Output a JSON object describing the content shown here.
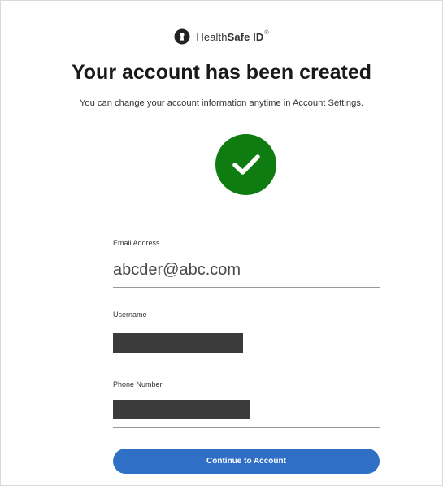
{
  "brand": {
    "name_regular": "Health",
    "name_bold": "Safe ID",
    "trademark": "®",
    "icon": "shield-keyhole-icon"
  },
  "header": {
    "title": "Your account has been created",
    "subtitle": "You can change your account information anytime in Account Settings."
  },
  "status": {
    "icon": "check-circle-icon",
    "color": "#0e7c11"
  },
  "fields": {
    "email": {
      "label": "Email Address",
      "value": "abcder@abc.com"
    },
    "username": {
      "label": "Username",
      "value_redacted": true
    },
    "phone": {
      "label": "Phone Number",
      "value_redacted": true
    }
  },
  "actions": {
    "continue_label": "Continue to Account",
    "continue_color": "#2f6fc6"
  }
}
